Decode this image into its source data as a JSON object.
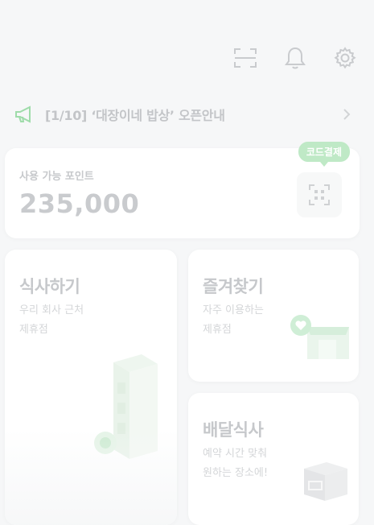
{
  "header": {
    "icons": [
      "scan-icon",
      "bell-icon",
      "gear-icon"
    ]
  },
  "notice": {
    "text": "[1/10] ‘대장이네 밥상’ 오픈안내"
  },
  "points": {
    "label": "사용 가능 포인트",
    "value": "235,000",
    "code_pay_label": "코드결제"
  },
  "cards": {
    "dine": {
      "title": "식사하기",
      "subtitle": "우리 회사 근처\n제휴점"
    },
    "favorites": {
      "title": "즐겨찾기",
      "subtitle": "자주 이용하는\n제휴점"
    },
    "delivery": {
      "title": "배달식사",
      "subtitle": "예약 시간 맞춰\n원하는 장소에!"
    }
  },
  "colors": {
    "accent": "#9fdcaa",
    "badge": "#bfe9c6",
    "background": "#f6f7f8"
  }
}
